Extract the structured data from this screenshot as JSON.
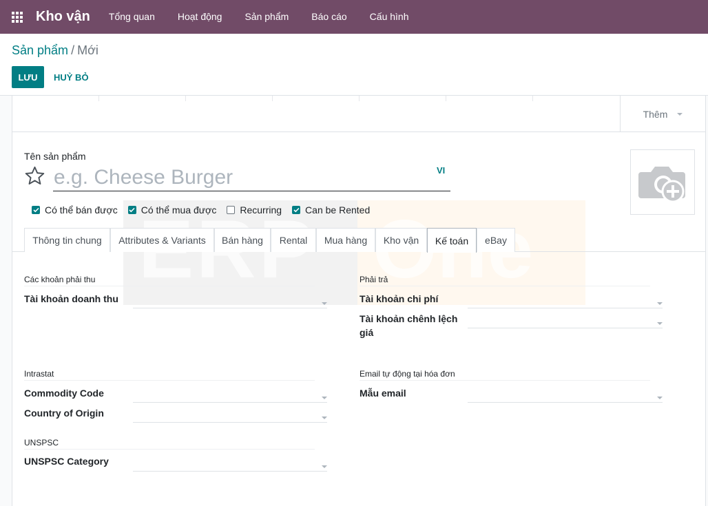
{
  "app": {
    "name": "Kho vận",
    "menu": [
      "Tổng quan",
      "Hoạt động",
      "Sản phẩm",
      "Báo cáo",
      "Cấu hình"
    ]
  },
  "breadcrumb": {
    "parent": "Sản phẩm",
    "separator": "/",
    "current": "Mới"
  },
  "actions": {
    "save": "LƯU",
    "discard": "HUỶ BỎ"
  },
  "button_box": {
    "more": "Thêm"
  },
  "form": {
    "name_label": "Tên sản phẩm",
    "name_placeholder": "e.g. Cheese Burger",
    "lang": "VI",
    "checkboxes": [
      {
        "label": "Có thể bán được",
        "checked": true
      },
      {
        "label": "Có thể mua được",
        "checked": true
      },
      {
        "label": "Recurring",
        "checked": false
      },
      {
        "label": "Can be Rented",
        "checked": true
      }
    ]
  },
  "tabs": [
    "Thông tin chung",
    "Attributes & Variants",
    "Bán hàng",
    "Rental",
    "Mua hàng",
    "Kho vận",
    "Kế toán",
    "eBay"
  ],
  "active_tab": "Kế toán",
  "watermark": {
    "left": "ERP",
    "right": "One"
  },
  "groups": {
    "receivable": {
      "title": "Các khoản phải thu",
      "income_account": "Tài khoản doanh thu"
    },
    "payable": {
      "title": "Phải trả",
      "expense_account": "Tài khoản chi phí",
      "price_diff_line1": "Tài khoản chênh lệch",
      "price_diff_line2": "giá"
    },
    "intrastat": {
      "title": "Intrastat",
      "commodity_code": "Commodity Code",
      "country_of_origin": "Country of Origin"
    },
    "email": {
      "title": "Email tự động tại hóa đơn",
      "template": "Mẫu email"
    },
    "unspsc": {
      "title": "UNSPSC",
      "category": "UNSPSC Category"
    }
  },
  "colors": {
    "nav_bg": "#714B67",
    "primary": "#017e84"
  },
  "icons": [
    "apps-grid-icon",
    "star-icon",
    "camera-add-icon",
    "chevron-down-icon",
    "checkbox-icon"
  ]
}
